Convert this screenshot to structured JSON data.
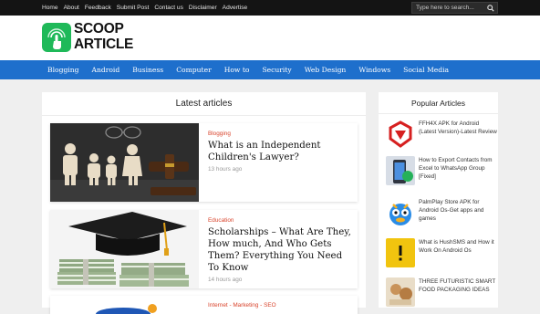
{
  "top_nav": {
    "links": [
      "Home",
      "About",
      "Feedback",
      "Submit Post",
      "Contact us",
      "Disclaimer",
      "Advertise"
    ],
    "search_placeholder": "Type here to search..."
  },
  "logo": {
    "line1": "SCOOP",
    "line2": "ARTICLE"
  },
  "main_nav": [
    "Blogging",
    "Android",
    "Business",
    "Computer",
    "How to",
    "Security",
    "Web Design",
    "Windows",
    "Social Media"
  ],
  "latest": {
    "title": "Latest articles",
    "articles": [
      {
        "category": "Blogging",
        "title": "What is an Independent Children's Lawyer?",
        "time": "13 hours ago"
      },
      {
        "category": "Education",
        "title": "Scholarships – What Are They, How much, And Who Gets Them? Everything You Need To Know",
        "time": "14 hours ago"
      },
      {
        "category": "Internet - Marketing - SEO",
        "title": "",
        "time": ""
      }
    ]
  },
  "popular": {
    "title": "Popular Articles",
    "items": [
      {
        "title": "FFH4X APK for Android (Latest Version)-Latest Review"
      },
      {
        "title": "How to Export Contacts from Excel to WhatsApp Group [Fixed]"
      },
      {
        "title": "PalmPlay Store APK for Android Os-Get apps and games"
      },
      {
        "title": "What is HushSMS and How it Work On Android Os"
      },
      {
        "title": "THREE FUTURISTIC SMART FOOD PACKAGING IDEAS"
      }
    ]
  },
  "colors": {
    "accent": "#1e6fcc",
    "category": "#d9442c",
    "logo_green": "#1fb959",
    "topbar": "#141414"
  }
}
